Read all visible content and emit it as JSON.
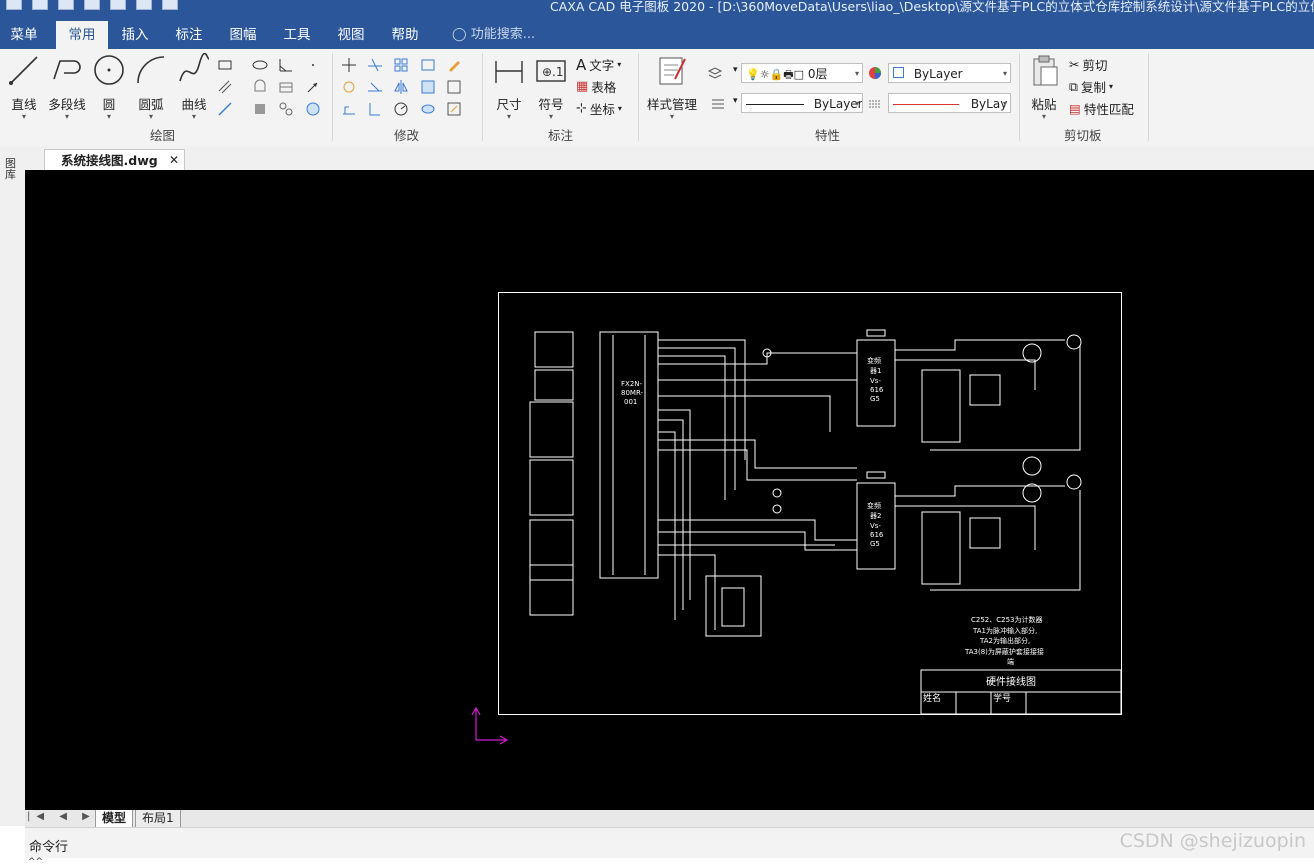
{
  "window": {
    "title": "CAXA CAD 电子图板 2020 - [D:\\360MoveData\\Users\\liao_\\Desktop\\源文件基于PLC的立体式仓库控制系统设计\\源文件基于PLC的立体式仓"
  },
  "menubar": {
    "tabs": [
      "菜单",
      "常用",
      "插入",
      "标注",
      "图幅",
      "工具",
      "视图",
      "帮助"
    ],
    "active": "常用",
    "search_placeholder": "功能搜索..."
  },
  "ribbon": {
    "draw": {
      "label": "绘图",
      "line": "直线",
      "polyline": "多段线",
      "circle": "圆",
      "arc": "圆弧",
      "curve": "曲线"
    },
    "modify": {
      "label": "修改"
    },
    "annotate": {
      "label": "标注",
      "dimension": "尺寸",
      "symbol": "符号",
      "text": "文字",
      "table": "表格",
      "coordinate": "坐标"
    },
    "style": {
      "style_manage": "样式管理"
    },
    "properties": {
      "label": "特性",
      "layer": "0层",
      "color": "ByLayer",
      "linetype": "ByLayer",
      "lineweight": "ByLay"
    },
    "clipboard": {
      "label": "剪切板",
      "paste": "粘贴",
      "cut": "剪切",
      "copy": "复制",
      "match": "特性匹配"
    }
  },
  "document": {
    "tab": "系统接线图.dwg",
    "close": "✕"
  },
  "left_panel": {
    "label": "图库"
  },
  "drawing": {
    "plc_label": [
      "FX2N-",
      "80MR-",
      "001"
    ],
    "inverter1": [
      "变频",
      "器1",
      "Vs-",
      "616",
      "G5"
    ],
    "inverter2": [
      "变频",
      "器2",
      "Vs-",
      "616",
      "G5"
    ],
    "notes": [
      "C252、C253为计数器",
      "TA1为脉冲输入部分,",
      "TA2为输出部分,",
      "TA3(8)为屏蔽护套接接接",
      "端"
    ],
    "title_block": {
      "title": "硬件接线图",
      "name_label": "姓名",
      "id_label": "学号"
    }
  },
  "layout_tabs": {
    "nav": "|◀ ◀ ▶ ▶|",
    "items": [
      "模型",
      "布局1"
    ],
    "active": "模型"
  },
  "command": {
    "label": "命令行",
    "input": "^^"
  },
  "watermark": "CSDN @shejizuopin"
}
